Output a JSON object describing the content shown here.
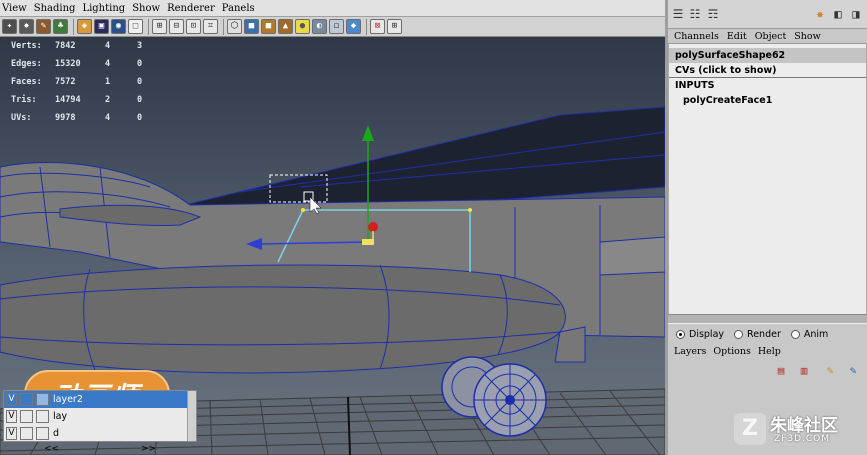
{
  "viewport": {
    "menu": [
      "View",
      "Shading",
      "Lighting",
      "Show",
      "Renderer",
      "Panels"
    ],
    "toolbar_icons": [
      "select-icon",
      "lasso-icon",
      "paint-icon",
      "brush-icon",
      "sep",
      "wireframe-icon",
      "smooth-shade-icon",
      "camera-icon",
      "sep",
      "grid-icon",
      "film-gate-icon",
      "resolution-gate-icon",
      "sep",
      "cube-icon",
      "textured-icon",
      "light-icon",
      "bulb-icon",
      "shadow-icon",
      "sep",
      "isolate-icon",
      "xray-icon"
    ]
  },
  "hud": {
    "rows": [
      {
        "label": "Verts:",
        "value": "7842",
        "c1": "4",
        "c2": "3"
      },
      {
        "label": "Edges:",
        "value": "15320",
        "c1": "4",
        "c2": "0"
      },
      {
        "label": "Faces:",
        "value": "7572",
        "c1": "1",
        "c2": "0"
      },
      {
        "label": "Tris:",
        "value": "14794",
        "c1": "2",
        "c2": "0"
      },
      {
        "label": "UVs:",
        "value": "9978",
        "c1": "4",
        "c2": "0"
      }
    ]
  },
  "logo": {
    "text": "动画师"
  },
  "colors": {
    "accent_selection": "#3a79c8",
    "manipulator_y": "#1ca61c",
    "manipulator_x": "#2d3fd8",
    "edge_wire": "#1e2ea8",
    "logo_orange": "#e89333"
  },
  "channels": {
    "menu": [
      "Channels",
      "Edit",
      "Object",
      "Show"
    ],
    "shape_name": "polySurfaceShape62",
    "cvs_label": "CVs (click to show)",
    "inputs_label": "INPUTS",
    "input_node": "polyCreateFace1"
  },
  "layers": {
    "radio": [
      {
        "label": "Display",
        "checked": true
      },
      {
        "label": "Render",
        "checked": false
      },
      {
        "label": "Anim",
        "checked": false
      }
    ],
    "menu": [
      "Layers",
      "Options",
      "Help"
    ],
    "rows": [
      {
        "visible": "V",
        "name": "layer2",
        "selected": true
      },
      {
        "visible": "V",
        "name": "lay",
        "selected": false
      },
      {
        "visible": "V",
        "name": "d",
        "selected": false
      }
    ],
    "nav_prev": "<<",
    "nav_next": ">>"
  },
  "watermark": {
    "text": "朱峰社区",
    "sub": "ZF3D.COM"
  }
}
